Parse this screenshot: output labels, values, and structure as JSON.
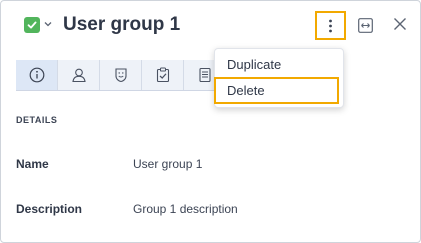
{
  "header": {
    "title": "User group 1",
    "status_icon": "check-icon",
    "status_color": "#52b55c"
  },
  "tabs": [
    {
      "icon": "info-icon",
      "active": true
    },
    {
      "icon": "user-icon",
      "active": false
    },
    {
      "icon": "badge-icon",
      "active": false
    },
    {
      "icon": "clipboard-check-icon",
      "active": false
    },
    {
      "icon": "document-icon",
      "active": false
    }
  ],
  "menu": {
    "items": [
      "Duplicate",
      "Delete"
    ],
    "highlight_color": "#f2a900"
  },
  "details": {
    "section_label": "DETAILS",
    "name_label": "Name",
    "name_value": "User group 1",
    "description_label": "Description",
    "description_value": "Group 1 description"
  }
}
